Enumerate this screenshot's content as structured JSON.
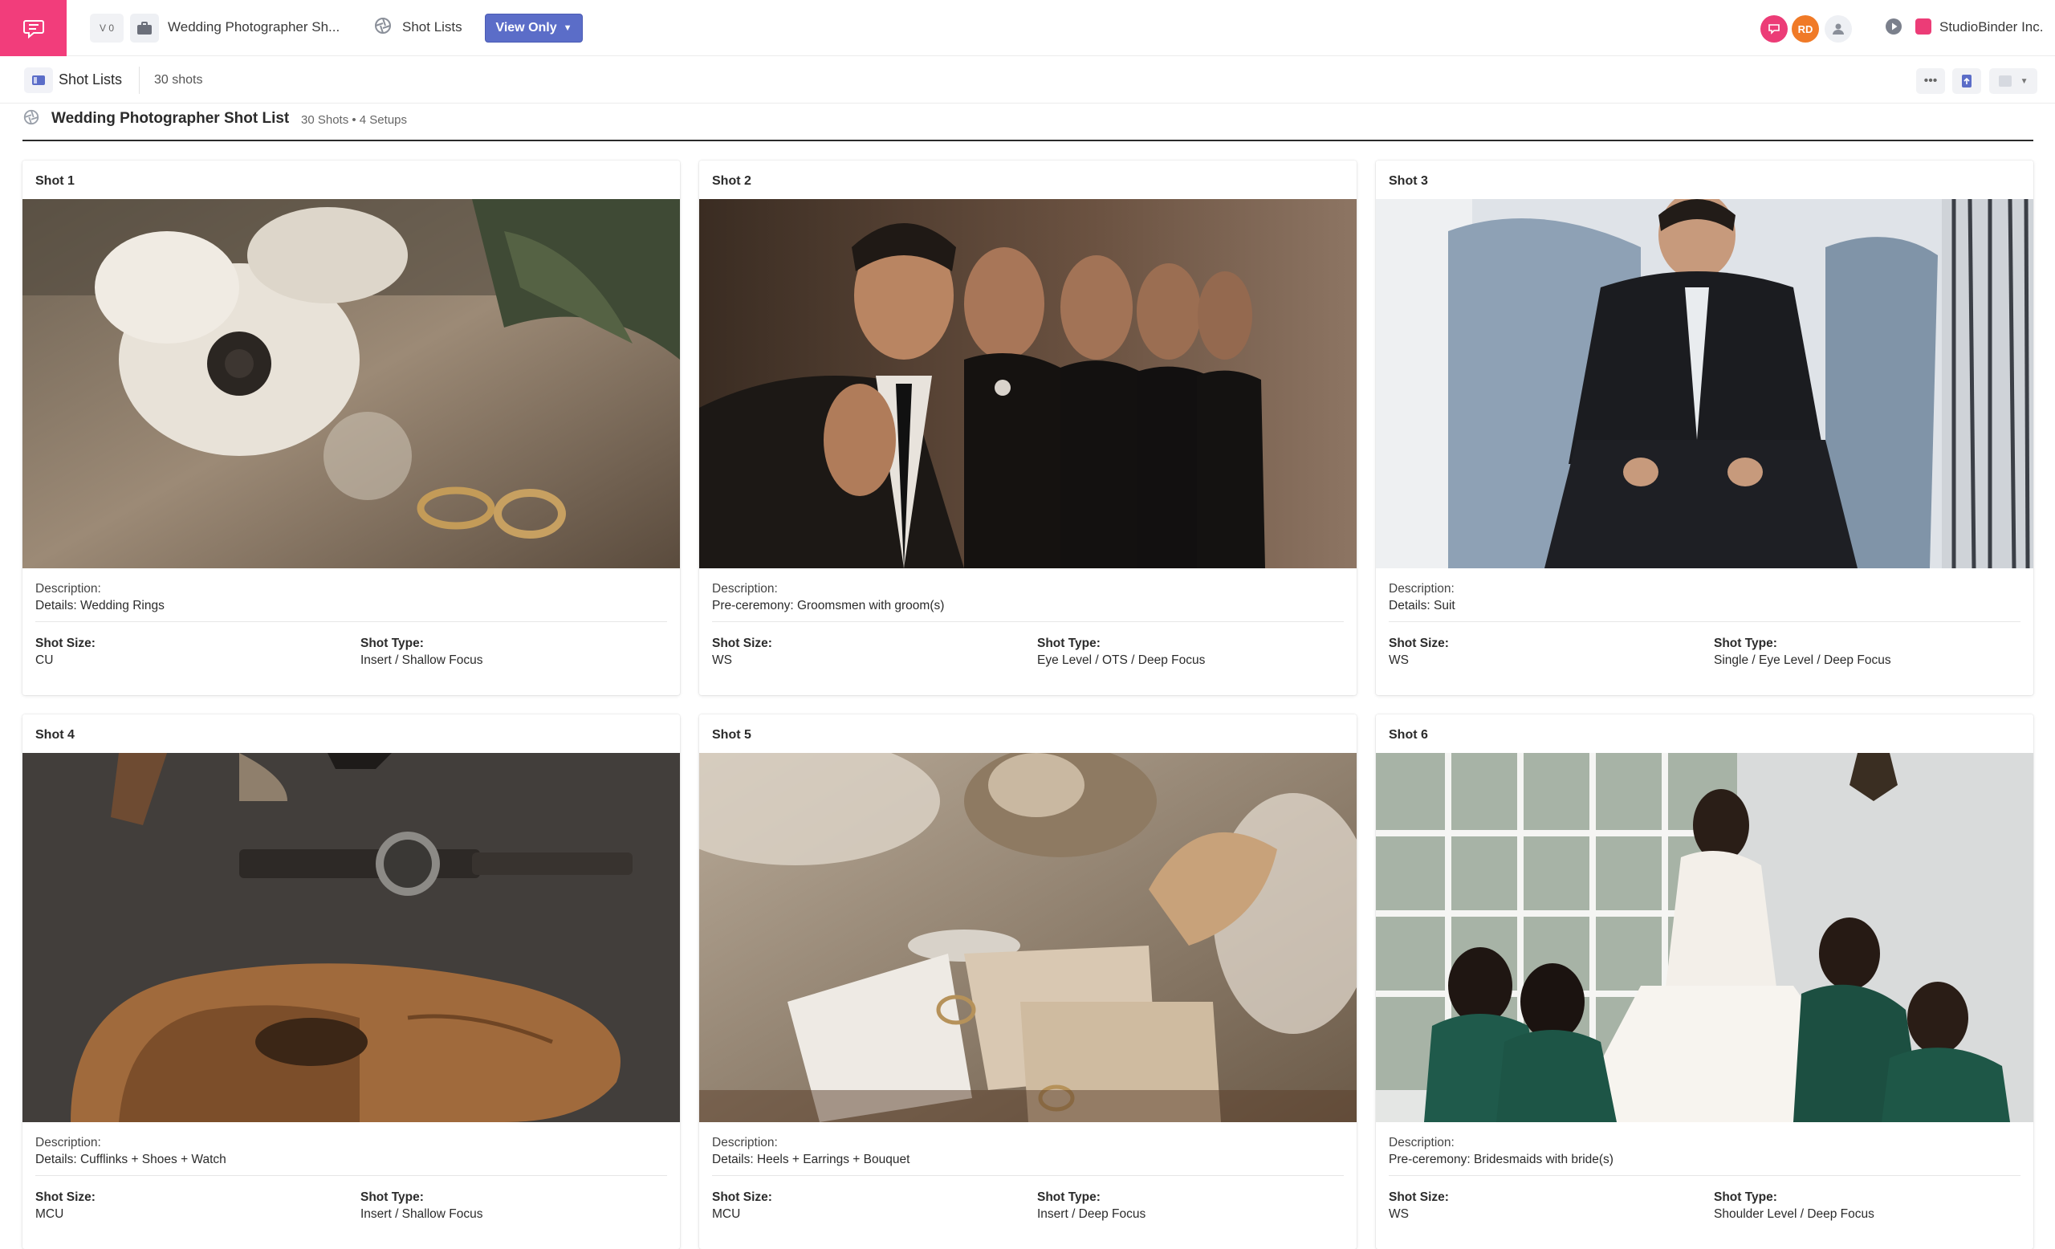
{
  "topbar": {
    "version": "V 0",
    "project_name": "Wedding Photographer Sh...",
    "section": "Shot Lists",
    "view_only": "View Only",
    "avatar_initials": "RD",
    "company": "StudioBinder Inc.",
    "brand_color": "#f23d7b",
    "accent_color": "#5b6dc8"
  },
  "subbar": {
    "title": "Shot Lists",
    "count": "30 shots"
  },
  "list": {
    "title": "Wedding Photographer Shot List",
    "meta": "30 Shots • 4 Setups"
  },
  "labels": {
    "description": "Description:",
    "shot_size": "Shot Size:",
    "shot_type": "Shot Type:"
  },
  "shots": [
    {
      "label": "Shot  1",
      "description": "Details: Wedding Rings",
      "size": "CU",
      "type": "Insert / Shallow Focus"
    },
    {
      "label": "Shot  2",
      "description": "Pre-ceremony: Groomsmen with groom(s)",
      "size": "WS",
      "type": "Eye Level / OTS / Deep Focus"
    },
    {
      "label": "Shot  3",
      "description": "Details: Suit",
      "size": "WS",
      "type": "Single / Eye Level / Deep Focus"
    },
    {
      "label": "Shot  4",
      "description": "Details: Cufflinks + Shoes + Watch",
      "size": "MCU",
      "type": "Insert / Shallow Focus"
    },
    {
      "label": "Shot  5",
      "description": "Details: Heels + Earrings + Bouquet",
      "size": "MCU",
      "type": "Insert / Deep Focus"
    },
    {
      "label": "Shot  6",
      "description": "Pre-ceremony: Bridesmaids with bride(s)",
      "size": "WS",
      "type": "Shoulder Level / Deep Focus"
    }
  ]
}
